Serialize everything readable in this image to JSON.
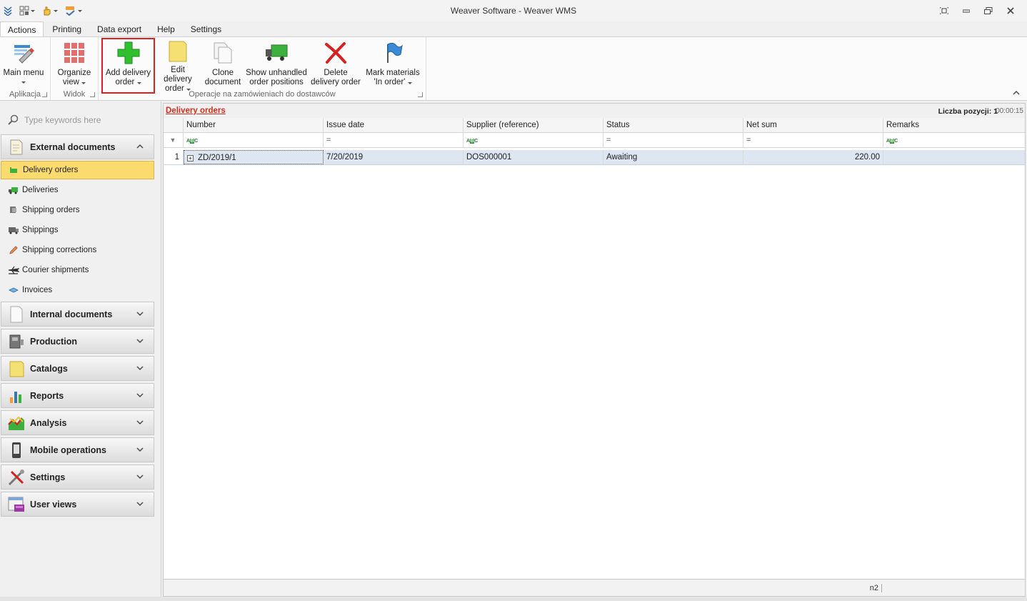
{
  "app": {
    "title": "Weaver Software - Weaver WMS"
  },
  "tabs": [
    "Actions",
    "Printing",
    "Data export",
    "Help",
    "Settings"
  ],
  "ribbon": {
    "groups": [
      {
        "label": "Aplikacja"
      },
      {
        "label": "Widok"
      },
      {
        "label": "Operacje na zamówieniach do dostawców"
      }
    ],
    "buttons": {
      "main_menu": {
        "line1": "Main menu",
        "line2": ""
      },
      "organize_view": {
        "line1": "Organize",
        "line2": "view"
      },
      "add_delivery_order": {
        "line1": "Add delivery",
        "line2": "order"
      },
      "edit_delivery_order": {
        "line1": "Edit delivery",
        "line2": "order"
      },
      "clone_document": {
        "line1": "Clone",
        "line2": "document"
      },
      "show_unhandled": {
        "line1": "Show unhandled",
        "line2": "order positions"
      },
      "delete_delivery_order": {
        "line1": "Delete",
        "line2": "delivery order"
      },
      "mark_materials": {
        "line1": "Mark materials",
        "line2": "'In order'"
      }
    }
  },
  "sidebar": {
    "search_placeholder": "Type keywords here",
    "groups": {
      "external": "External documents",
      "internal": "Internal documents",
      "production": "Production",
      "catalogs": "Catalogs",
      "reports": "Reports",
      "analysis": "Analysis",
      "mobile": "Mobile operations",
      "settings": "Settings",
      "user_views": "User views"
    },
    "items": [
      "Delivery orders",
      "Deliveries",
      "Shipping orders",
      "Shippings",
      "Shipping corrections",
      "Courier shipments",
      "Invoices"
    ]
  },
  "main": {
    "view_title": "Delivery orders",
    "count_label": "Liczba pozycji: 1",
    "timer": "00:00:15",
    "columns": [
      "Number",
      "Issue date",
      "Supplier (reference)",
      "Status",
      "Net sum",
      "Remarks"
    ],
    "rows": [
      {
        "rn": "1",
        "number": "ZD/2019/1",
        "issue_date": "7/20/2019",
        "supplier": "DOS000001",
        "status": "Awaiting",
        "net_sum": "220.00",
        "remarks": ""
      }
    ],
    "footer_value": "n2"
  },
  "colors": {
    "accent_red": "#d32f1f",
    "selection_yellow": "#fbdb6d",
    "row_selected": "#dde6f1"
  }
}
